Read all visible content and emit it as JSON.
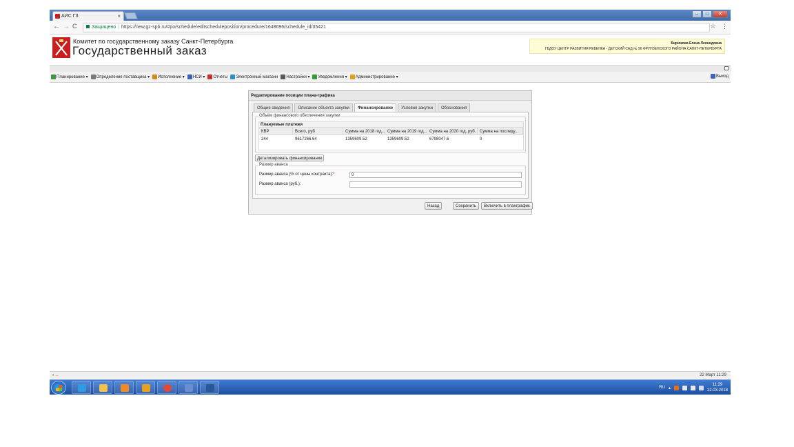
{
  "browser": {
    "tab_title": "АИС ГЗ",
    "tab_close": "×",
    "secure_label": "Защищено",
    "url": "https://new.gz-spb.ru/#po/schedule/editscheduleposition/procedure/1648696/schedule_id/35421",
    "back": "←",
    "forward": "→",
    "reload": "C",
    "star": "☆",
    "menu": "⋮",
    "window_buttons": {
      "minimize": "–",
      "maximize": "□",
      "close": "✕"
    }
  },
  "site": {
    "org_top": "Комитет по государственному заказу Санкт-Петербурга",
    "org_main": "Государственный заказ",
    "user_name": "Бирюкова Елена Леонидовна",
    "user_org": "ГБДОУ ЦЕНТР РАЗВИТИЯ РЕБЕНКА - ДЕТСКИЙ САД № 96 ФРУНЗЕНСКОГО РАЙОНА САНКТ-ПЕТЕРБУРГА"
  },
  "menu": {
    "items": [
      {
        "label": "Планирование ▾",
        "icon": "planning-icon",
        "color": "#3c9a3c"
      },
      {
        "label": "Определение поставщика ▾",
        "icon": "supplier-icon",
        "color": "#7a7a7a"
      },
      {
        "label": "Исполнение ▾",
        "icon": "execution-icon",
        "color": "#d08a1e"
      },
      {
        "label": "НСИ ▾",
        "icon": "nsi-icon",
        "color": "#3b64b5"
      },
      {
        "label": "Отчеты",
        "icon": "reports-icon",
        "color": "#c73030"
      },
      {
        "label": "Электронный магазин",
        "icon": "eshop-icon",
        "color": "#2f8fc9"
      },
      {
        "label": "Настройки ▾",
        "icon": "settings-icon",
        "color": "#5a5a5a"
      },
      {
        "label": "Уведомления ▾",
        "icon": "notifications-icon",
        "color": "#3c9a3c"
      },
      {
        "label": "Администрирование ▾",
        "icon": "admin-icon",
        "color": "#e0a020"
      }
    ],
    "logout": "Выход"
  },
  "dialog": {
    "title": "Редактирование позиции плана-графика",
    "tabs": [
      "Общие сведения",
      "Описание объекта закупки",
      "Финансирование",
      "Условия закупки",
      "Обоснования"
    ],
    "active_tab": "Финансирование",
    "fin_legend": "Объём финансового обеспечения закупки",
    "grid_title": "Плануемые платежи",
    "columns": [
      "КВР",
      "Всего, руб",
      "Сумма на 2018 год...",
      "Сумма на 2019 год...",
      "Сумма на 2020 год, руб.",
      "Сумма на последу..."
    ],
    "rows": [
      [
        "244",
        "9617266.64",
        "1359609.52",
        "1359609.52",
        "6798047.6",
        "0"
      ]
    ],
    "detail_button": "Детализировать финансирование",
    "advance_legend": "Размер аванса",
    "advance_percent_label": "Размер аванса (% от цены контракта):",
    "advance_percent_required": "*",
    "advance_percent_value": "0",
    "advance_rub_label": "Размер аванса (руб.):",
    "advance_rub_value": "",
    "buttons": {
      "back": "Назад",
      "save": "Сохранить",
      "include": "Включить в планграфик"
    }
  },
  "statusbar": {
    "left": "◐ ...",
    "right": "22 Март 11:29"
  },
  "taskbar": {
    "apps": [
      {
        "name": "ie-icon",
        "color": "#2f9be0"
      },
      {
        "name": "explorer-icon",
        "color": "#f2c14e"
      },
      {
        "name": "media-player-icon",
        "color": "#f08a24"
      },
      {
        "name": "outlook-icon",
        "color": "#e8a020"
      },
      {
        "name": "chrome-icon",
        "color": "#e04a3a"
      },
      {
        "name": "remote-desktop-icon",
        "color": "#6a8fd0"
      },
      {
        "name": "word-icon",
        "color": "#2b579a"
      }
    ],
    "lang": "RU",
    "time": "11:29",
    "date": "22.03.2018"
  }
}
